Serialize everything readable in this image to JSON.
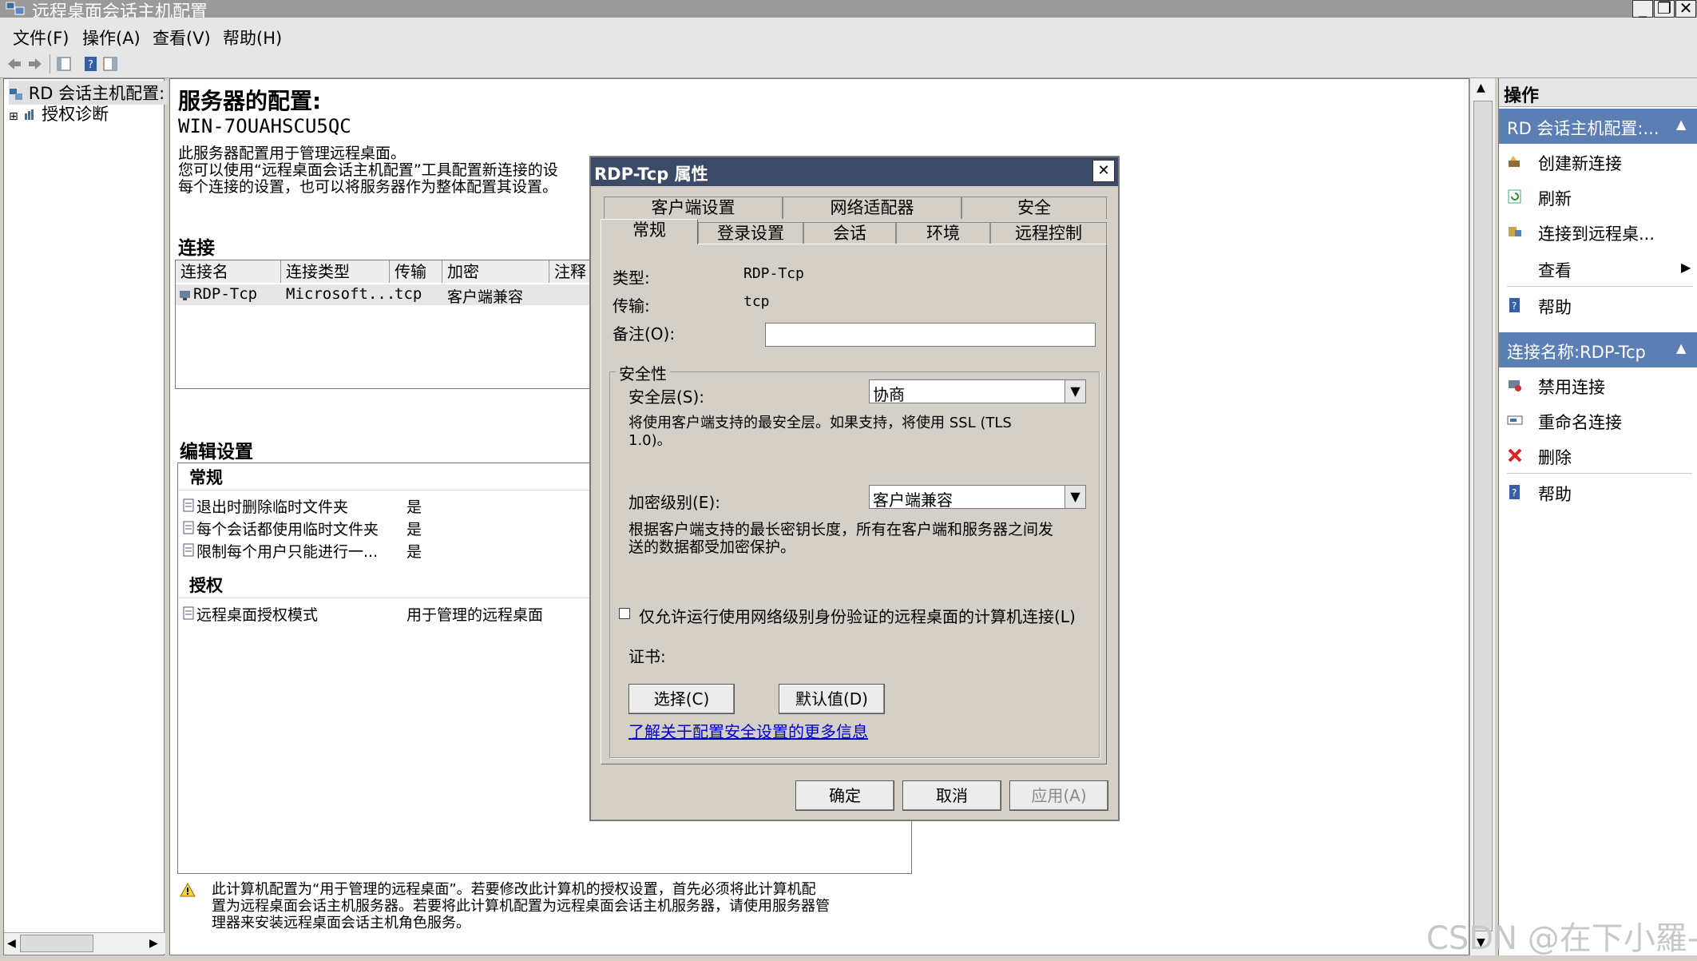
{
  "window": {
    "title": "远程桌面会话主机配置",
    "min_label": "_",
    "restore_label": "❐",
    "close_label": "✕"
  },
  "menu": [
    "文件(F)",
    "操作(A)",
    "查看(V)",
    "帮助(H)"
  ],
  "tree": {
    "root": "RD 会话主机配置:",
    "child": "授权诊断",
    "expander": "⊞"
  },
  "center": {
    "title": "服务器的配置:",
    "server_name": "WIN-7OUAHSCU5QC",
    "desc1": "此服务器配置用于管理远程桌面。",
    "desc2": "您可以使用“远程桌面会话主机配置”工具配置新连接的设",
    "desc3": "每个连接的设置，也可以将服务器作为整体配置其设置。",
    "connections_heading": "连接",
    "table": {
      "headers": [
        "连接名",
        "连接类型",
        "传输",
        "加密",
        "注释"
      ],
      "rows": [
        [
          "RDP-Tcp",
          "Microsoft...",
          "tcp",
          "客户端兼容",
          ""
        ]
      ]
    },
    "edit_heading": "编辑设置",
    "general_group": "常规",
    "settings": [
      {
        "name": "退出时删除临时文件夹",
        "value": "是"
      },
      {
        "name": "每个会话都使用临时文件夹",
        "value": "是"
      },
      {
        "name": "限制每个用户只能进行一...",
        "value": "是"
      }
    ],
    "license_group": "授权",
    "license_setting": {
      "name": "远程桌面授权模式",
      "value": "用于管理的远程桌面"
    },
    "warning_line1": "此计算机配置为“用于管理的远程桌面”。若要修改此计算机的授权设置，首先必须将此计算机配",
    "warning_line2": "置为远程桌面会话主机服务器。若要将此计算机配置为远程桌面会话主机服务器，请使用服务器管",
    "warning_line3": "理器来安装远程桌面会话主机角色服务。"
  },
  "actions": {
    "header": "操作",
    "section1": "RD 会话主机配置:...",
    "section1_items": [
      "创建新连接",
      "刷新",
      "连接到远程桌...",
      "查看",
      "帮助"
    ],
    "section2": "连接名称:RDP-Tcp",
    "section2_items": [
      "禁用连接",
      "重命名连接",
      "删除",
      "帮助"
    ],
    "collapse_glyph": "▲",
    "submenu_glyph": "▶"
  },
  "dialog": {
    "title": "RDP-Tcp 属性",
    "close_label": "✕",
    "tabs_row1": [
      "客户端设置",
      "网络适配器",
      "安全"
    ],
    "tabs_row2": [
      "常规",
      "登录设置",
      "会话",
      "环境",
      "远程控制"
    ],
    "type_label": "类型:",
    "type_value": "RDP-Tcp",
    "transport_label": "传输:",
    "transport_value": "tcp",
    "comment_label": "备注(O):",
    "comment_value": "",
    "security_group": "安全性",
    "security_layer_label": "安全层(S):",
    "security_layer_value": "协商",
    "security_layer_desc1": "将使用客户端支持的最安全层。如果支持，将使用 SSL (TLS",
    "security_layer_desc2": "1.0)。",
    "encryption_label": "加密级别(E):",
    "encryption_value": "客户端兼容",
    "encryption_desc1": "根据客户端支持的最长密钥长度，所有在客户端和服务器之间发",
    "encryption_desc2": "送的数据都受加密保护。",
    "nla_checkbox": "仅允许运行使用网络级别身份验证的远程桌面的计算机连接(L)",
    "cert_label": "证书:",
    "select_btn": "选择(C)",
    "default_btn": "默认值(D)",
    "link": "了解关于配置安全设置的更多信息",
    "ok_btn": "确定",
    "cancel_btn": "取消",
    "apply_btn": "应用(A)"
  },
  "watermark": "CSDN @在下小羅-",
  "colors": {
    "accent": "#5b7fb4",
    "dialog_title": "#3b4a66",
    "link": "#0000cc"
  }
}
